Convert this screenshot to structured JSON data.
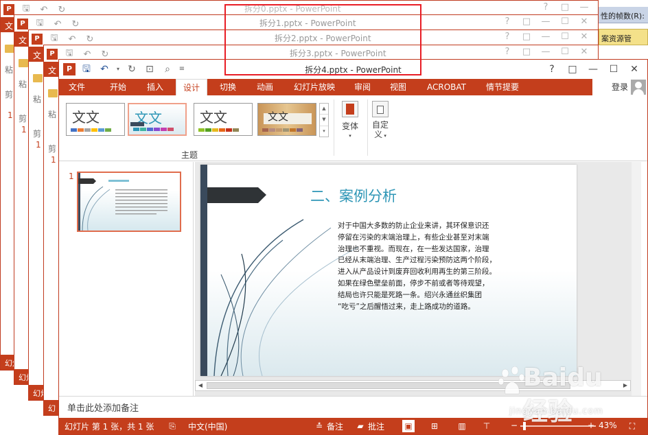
{
  "peek_window": {
    "line1": "性的帧数(R):",
    "line2": "案资源管"
  },
  "background_windows": [
    {
      "title": "拆分0.pptx - PowerPoint",
      "left_glyph": "文",
      "menu_glyph": "粘",
      "ribbon_glyph": "剪",
      "num": "1",
      "footer": "幻灯"
    },
    {
      "title": "拆分1.pptx - PowerPoint",
      "left_glyph": "文",
      "menu_glyph": "粘",
      "ribbon_glyph": "剪",
      "num": "1",
      "footer": "幻灯"
    },
    {
      "title": "拆分2.pptx - PowerPoint",
      "left_glyph": "文",
      "menu_glyph": "粘",
      "ribbon_glyph": "剪",
      "num": "1",
      "footer": "幻灯"
    },
    {
      "title": "拆分3.pptx - PowerPoint",
      "left_glyph": "文",
      "menu_glyph": "粘",
      "ribbon_glyph": "剪",
      "num": "1",
      "footer": "幻"
    }
  ],
  "main_window": {
    "title": "拆分4.pptx - PowerPoint",
    "controls": {
      "help": "?",
      "restore": "□",
      "minimize": "—",
      "maximize": "☐",
      "close": "✕"
    },
    "tabs": [
      "文件",
      "开始",
      "插入",
      "设计",
      "切换",
      "动画",
      "幻灯片放映",
      "审阅",
      "视图",
      "ACROBAT",
      "情节提要"
    ],
    "active_tab": "设计",
    "login": "登录"
  },
  "ribbon": {
    "themes": [
      {
        "text": "文文",
        "selected": false
      },
      {
        "text": "文文",
        "selected": true
      },
      {
        "text": "文文",
        "selected": false
      },
      {
        "text": "文文",
        "selected": false
      }
    ],
    "variants_label": "变体",
    "customize_label_1": "自定",
    "customize_label_2": "义",
    "group_label": "主题"
  },
  "slide_panel": {
    "slide_number": "1"
  },
  "slide": {
    "title": "二、案例分析",
    "body_lines": [
      "对于中国大多数的防止企业来讲，其环保意识还",
      "停留在污染的末端治理上，有些企业甚至对末端",
      "治理也不重视。而现在，在一些发达国家，治理",
      "已经从末端治理、生产过程污染预防这两个阶段，",
      "进入从产品设计到废弃回收利用再生的第三阶段。",
      "如果在绿色壁垒前面，停步不前或者等待观望，",
      "结局也许只能是死路一条。绍兴永通丝织集团",
      "“吃亏”之后醒悟过来，走上路成功的道路。"
    ]
  },
  "notes_placeholder": "单击此处添加备注",
  "status_bar": {
    "slide_info": "幻灯片 第 1 张，共 1 张",
    "language": "中文(中国)",
    "notes_label": "备注",
    "comments_label": "批注",
    "zoom": "43%",
    "minus": "−",
    "plus": "+"
  },
  "watermark": {
    "brand": "Baidu经验",
    "url": "jingyan.baidu.com"
  },
  "colors": {
    "accent": "#c43e1c",
    "title_blue": "#2e96b6",
    "highlight": "#e81c24"
  }
}
